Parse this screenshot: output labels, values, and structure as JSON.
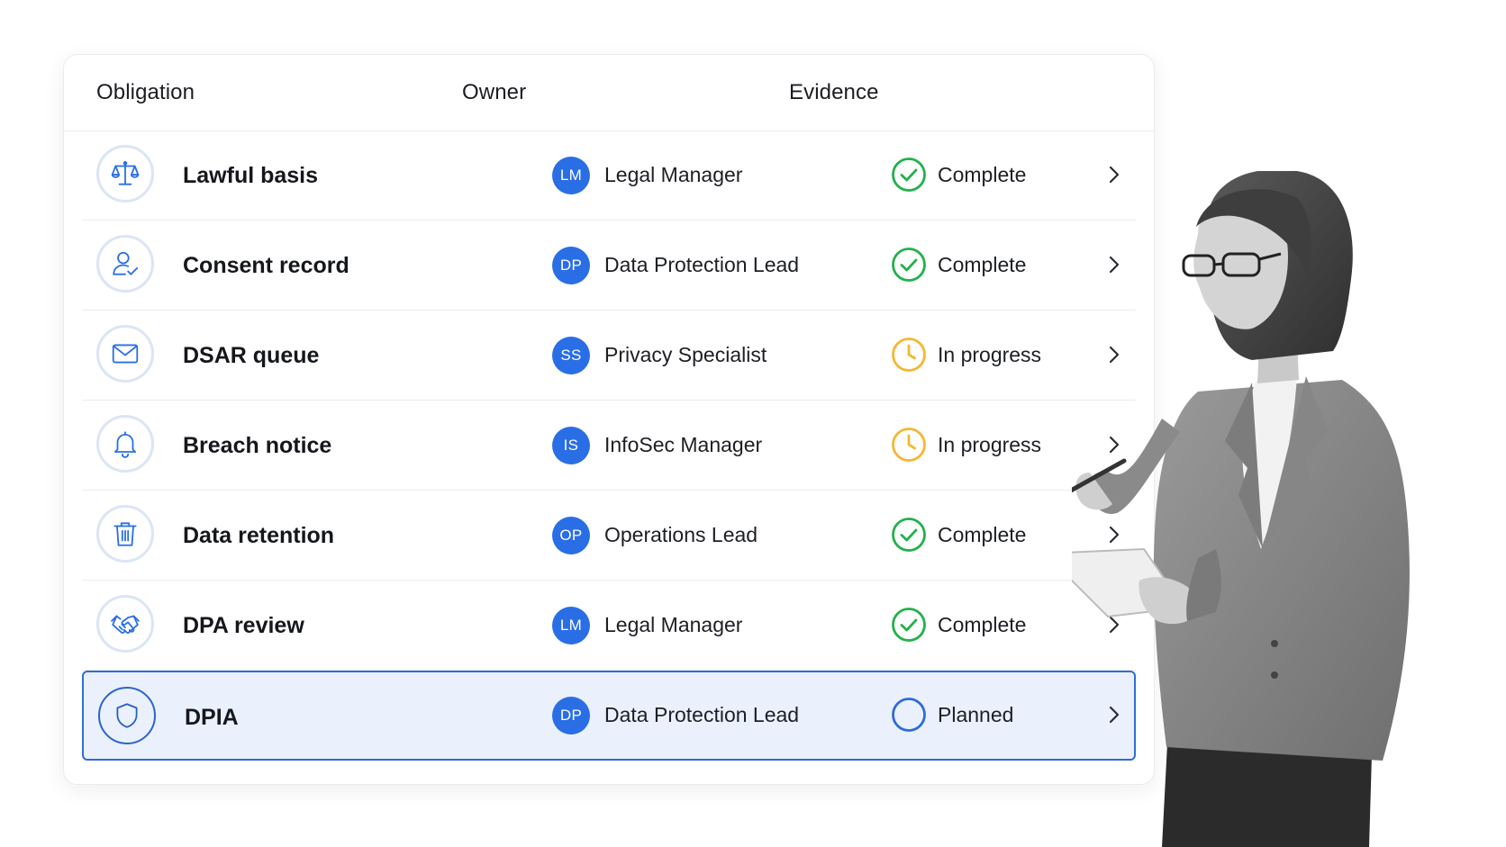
{
  "table": {
    "headers": {
      "obligation": "Obligation",
      "owner": "Owner",
      "evidence": "Evidence"
    },
    "rows": [
      {
        "obligation": "Lawful basis",
        "icon": "scale-icon",
        "owner_initials": "LM",
        "owner": "Legal Manager",
        "status": "Complete",
        "status_icon": "check-circle-icon"
      },
      {
        "obligation": "Consent record",
        "icon": "user-check-icon",
        "owner_initials": "DP",
        "owner": "Data Protection Lead",
        "status": "Complete",
        "status_icon": "check-circle-icon"
      },
      {
        "obligation": "DSAR queue",
        "icon": "envelope-icon",
        "owner_initials": "SS",
        "owner": "Privacy Specialist",
        "status": "In progress",
        "status_icon": "clock-icon"
      },
      {
        "obligation": "Breach notice",
        "icon": "bell-icon",
        "owner_initials": "IS",
        "owner": "InfoSec Manager",
        "status": "In progress",
        "status_icon": "clock-icon"
      },
      {
        "obligation": "Data retention",
        "icon": "trash-icon",
        "owner_initials": "OP",
        "owner": "Operations Lead",
        "status": "Complete",
        "status_icon": "check-circle-icon"
      },
      {
        "obligation": "DPA review",
        "icon": "handshake-icon",
        "owner_initials": "LM",
        "owner": "Legal Manager",
        "status": "Complete",
        "status_icon": "check-circle-icon"
      },
      {
        "obligation": "DPIA",
        "icon": "shield-icon",
        "owner_initials": "DP",
        "owner": "Data Protection Lead",
        "status": "Planned",
        "status_icon": "empty-circle-icon",
        "selected": true
      }
    ]
  },
  "colors": {
    "accent": "#2a6ee6",
    "complete": "#22b14c",
    "in_progress": "#f5b731",
    "planned": "#2f6bd9",
    "selected_row_bg": "#eaf1fd"
  }
}
